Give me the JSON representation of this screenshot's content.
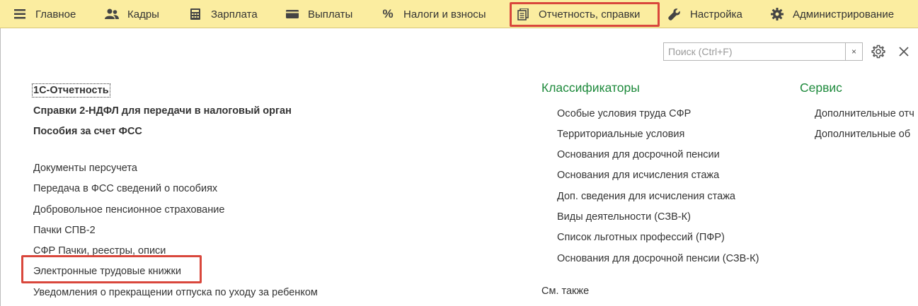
{
  "menu": {
    "items": [
      {
        "label": "Главное",
        "icon": "hamburger-icon"
      },
      {
        "label": "Кадры",
        "icon": "people-icon"
      },
      {
        "label": "Зарплата",
        "icon": "calculator-icon"
      },
      {
        "label": "Выплаты",
        "icon": "wallet-icon"
      },
      {
        "label": "Налоги и взносы",
        "icon": "percent-icon"
      },
      {
        "label": "Отчетность, справки",
        "icon": "documents-icon"
      },
      {
        "label": "Настройка",
        "icon": "wrench-icon"
      },
      {
        "label": "Администрирование",
        "icon": "gear-icon"
      }
    ],
    "active_index": 5,
    "highlight_color": "#d9473c",
    "bar_color": "#fbeda0"
  },
  "search": {
    "placeholder": "Поиск (Ctrl+F)",
    "value": "",
    "clear_glyph": "×"
  },
  "left": {
    "bold_links": [
      "1С-Отчетность",
      "Справки 2-НДФЛ для передачи в налоговый орган",
      "Пособия за счет ФСС"
    ],
    "links": [
      "Документы персучета",
      "Передача в ФСС сведений о пособиях",
      "Добровольное пенсионное страхование",
      "Пачки СПВ-2",
      "СФР Пачки, реестры, описи",
      "Электронные трудовые книжки",
      "Уведомления о прекращении отпуска по уходу за ребенком"
    ],
    "highlighted_index": 5
  },
  "classifiers": {
    "title": "Классификаторы",
    "items": [
      "Особые условия труда СФР",
      "Территориальные условия",
      "Основания для досрочной пенсии",
      "Основания для исчисления стажа",
      "Доп. сведения для исчисления стажа",
      "Виды деятельности (СЗВ-К)",
      "Список льготных профессий (ПФР)",
      "Основания для досрочной пенсии (СЗВ-К)"
    ],
    "see_also": "См. также"
  },
  "service": {
    "title": "Сервис",
    "items": [
      "Дополнительные отч",
      "Дополнительные об"
    ]
  },
  "colors": {
    "section_title": "#1e8a3c",
    "text": "#333333"
  }
}
